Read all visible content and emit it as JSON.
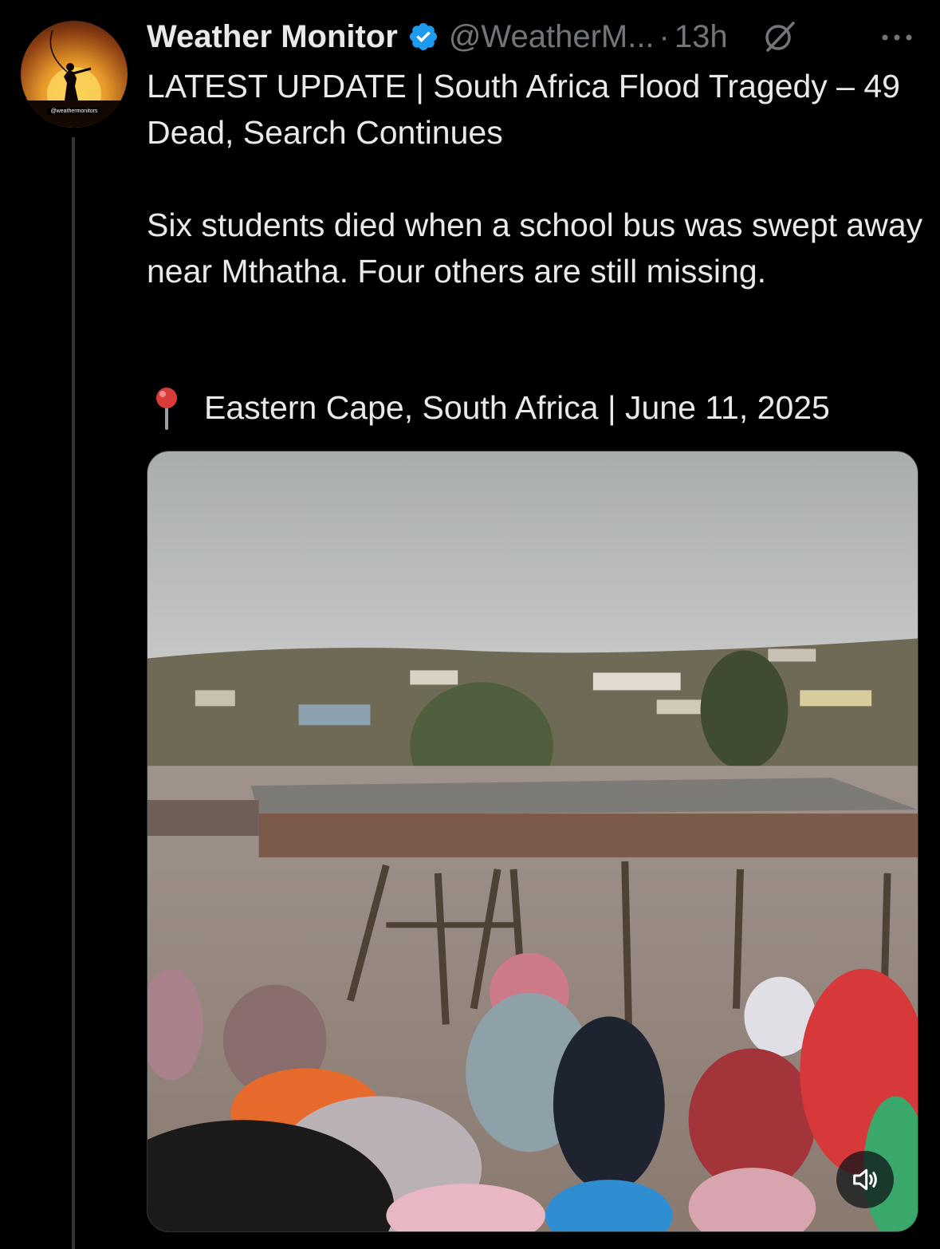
{
  "author": {
    "display_name": "Weather Monitor",
    "handle": "@WeatherM...",
    "separator": "·",
    "time_ago": "13h",
    "avatar_label": "@weathermonitors",
    "verified": true
  },
  "tweet": {
    "title": "LATEST UPDATE | South Africa Flood Tragedy – 49 Dead, Search Continues",
    "body": "Six students died when a school bus was swept away near Mthatha. Four others are still missing.",
    "location_emoji": "📍",
    "location": "Eastern Cape, South Africa | June 11, 2025"
  },
  "media": {
    "type": "video",
    "description_icon": "flood-video-thumbnail",
    "mute_icon": "speaker-muted-icon"
  },
  "icons": {
    "verified": "verified-badge-icon",
    "grok": "grok-icon",
    "more": "more-options-icon",
    "pin": "round-pushpin-icon"
  },
  "colors": {
    "background": "#000000",
    "text": "#e7e9ea",
    "muted": "#71767b",
    "verified": "#1d9bf0",
    "thread_line": "#333639"
  }
}
